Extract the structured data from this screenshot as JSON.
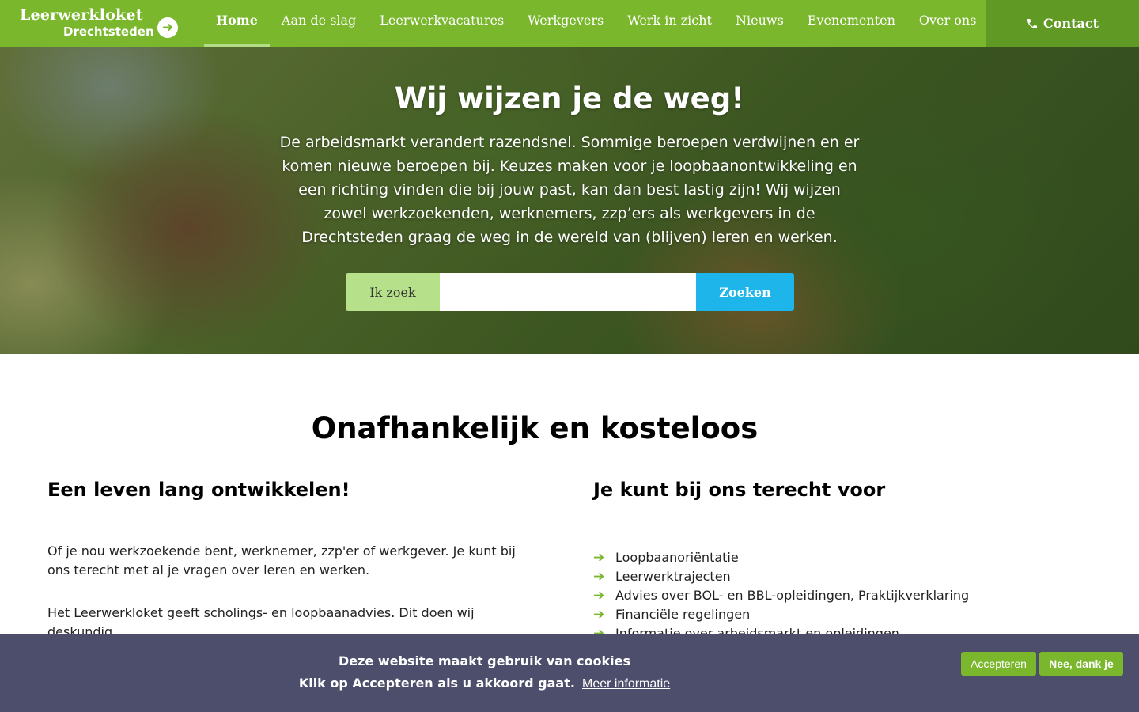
{
  "brand": {
    "title": "Leerwerkloket",
    "subtitle": "Drechtsteden",
    "arrow_icon": "arrow-right-circle-icon"
  },
  "nav": {
    "items": [
      {
        "label": "Home",
        "active": true
      },
      {
        "label": "Aan de slag",
        "active": false
      },
      {
        "label": "Leerwerkvacatures",
        "active": false
      },
      {
        "label": "Werkgevers",
        "active": false
      },
      {
        "label": "Werk in zicht",
        "active": false
      },
      {
        "label": "Nieuws",
        "active": false
      },
      {
        "label": "Evenementen",
        "active": false
      },
      {
        "label": "Over ons",
        "active": false
      }
    ],
    "contact_label": "Contact",
    "contact_icon": "phone-icon"
  },
  "hero": {
    "title": "Wij wijzen je de weg!",
    "text": "De arbeidsmarkt verandert razendsnel. Sommige beroepen verdwijnen en er komen nieuwe beroepen bij. Keuzes maken voor je loopbaanontwikkeling en een richting vinden die bij jouw past, kan dan best lastig zijn! Wij wijzen zowel werkzoekenden, werknemers, zzp’ers als werkgevers in de Drechtsteden graag de weg in de wereld van (blijven) leren en werken.",
    "search_label": "Ik zoek",
    "search_value": "",
    "search_button": "Zoeken"
  },
  "main": {
    "title": "Onafhankelijk en kosteloos",
    "left": {
      "heading": "Een leven lang ontwikkelen!",
      "paragraphs": [
        "Of je nou werkzoekende bent, werknemer, zzp'er of werkgever. Je kunt bij ons terecht met al je vragen over leren en werken.",
        "Het Leerwerkloket geeft scholings- en loopbaanadvies. Dit doen wij deskundig,"
      ]
    },
    "right": {
      "heading": "Je kunt bij ons terecht voor",
      "items": [
        "Loopbaanoriëntatie",
        "Leerwerktrajecten",
        "Advies over BOL- en BBL-opleidingen, Praktijkverklaring",
        "Financiële regelingen",
        "Informatie over arbeidsmarkt en opleidingen"
      ]
    }
  },
  "cookie": {
    "line1": "Deze website maakt gebruik van cookies",
    "line2": "Klik op Accepteren als u akkoord gaat.",
    "more_info": "Meer informatie",
    "accept": "Accepteren",
    "decline": "Nee, dank je"
  },
  "colors": {
    "brand_green": "#7ab72d",
    "contact_green": "#609a24",
    "search_blue": "#1eb6ea",
    "cookie_bar": "#4d4e6b"
  }
}
